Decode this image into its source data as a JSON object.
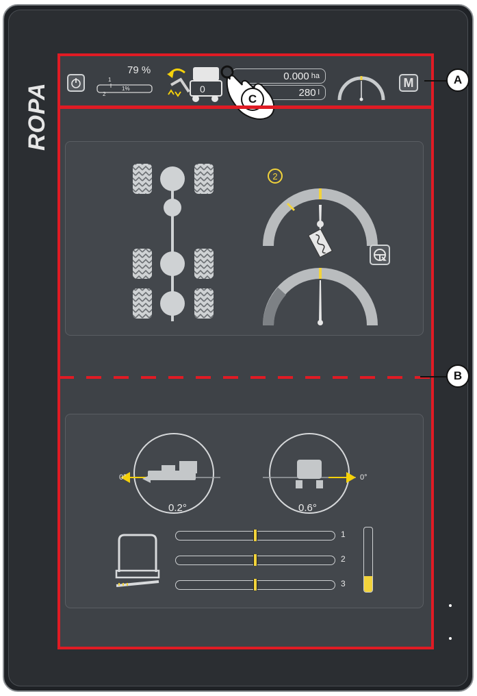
{
  "brand": "ROPA",
  "status_bar": {
    "fuel_percent": "79 %",
    "fuel_level": 0.79,
    "gauge_ticks": [
      "1",
      "1%",
      "2"
    ],
    "counter_value": "0",
    "area_value": "0.000",
    "area_unit": "ha",
    "volume_value": "280",
    "volume_unit": "l",
    "mode_button": "M"
  },
  "steering_panel": {
    "steering_program": "2"
  },
  "tilt_panel": {
    "left_angle": "0.2°",
    "left_zero": "0°",
    "right_angle": "0.6°",
    "right_zero": "0°",
    "sliders": [
      {
        "label": "1",
        "position": 0.5
      },
      {
        "label": "2",
        "position": 0.5
      },
      {
        "label": "3",
        "position": 0.5
      }
    ],
    "level_fill": 0.25
  },
  "callouts": {
    "a": "A",
    "b": "B",
    "c": "C"
  },
  "colors": {
    "highlight": "#e01b24",
    "accent": "#f2d33b",
    "arrow": "#f5d10a"
  }
}
